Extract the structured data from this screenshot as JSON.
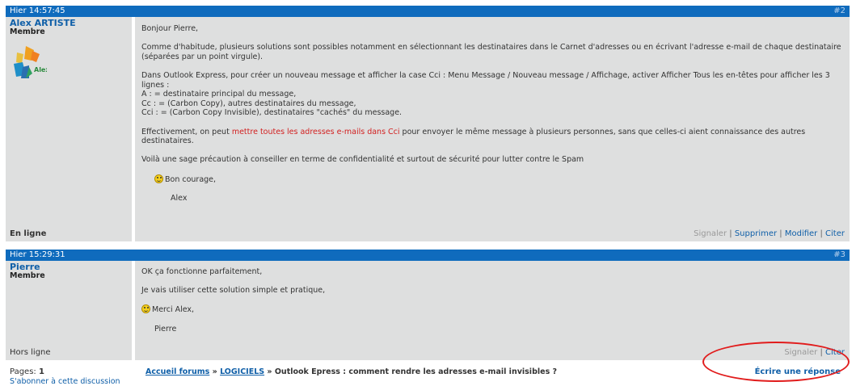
{
  "post1": {
    "time": "Hier 14:57:45",
    "number": "#2",
    "author": "Alex ARTISTE",
    "role": "Membre",
    "status": "En ligne",
    "greeting": "Bonjour Pierre,",
    "p1": "Comme d'habitude, plusieurs solutions sont possibles notamment en sélectionnant les destinataires dans le Carnet d'adresses ou en écrivant l'adresse e-mail de chaque destinataire (séparées par un point virgule).",
    "p2": "Dans Outlook Express, pour créer un nouveau message et afficher la case Cci : Menu Message / Nouveau message / Affichage, activer Afficher Tous les en-têtes pour afficher les 3 lignes :",
    "line_a": "A : = destinataire principal du message,",
    "line_cc": "Cc : = (Carbon Copy), autres destinataires du message,",
    "line_cci": "Cci : = (Carbon Copy Invisible), destinataires \"cachés\" du message.",
    "p3_before": "Effectivement, on peut ",
    "p3_red": "mettre toutes les adresses e-mails dans Cci",
    "p3_after": " pour envoyer le même message à plusieurs personnes, sans que celles-ci aient connaissance des autres destinataires.",
    "p4": "Voilà une sage précaution à conseiller en terme de confidentialité et surtout de sécurité pour lutter contre le Spam",
    "closing": "Bon courage,",
    "signature": "Alex",
    "avatar_text": "Alex",
    "actions": {
      "report": "Signaler",
      "delete": "Supprimer",
      "edit": "Modifier",
      "quote": "Citer"
    }
  },
  "post2": {
    "time": "Hier 15:29:31",
    "number": "#3",
    "author": "Pierre",
    "role": "Membre",
    "status": "Hors ligne",
    "p1": "OK ça fonctionne parfaitement,",
    "p2": "Je vais utiliser cette solution simple et pratique,",
    "closing": "Merci Alex,",
    "signature": "Pierre",
    "actions": {
      "report": "Signaler",
      "quote": "Citer"
    }
  },
  "footer": {
    "pages_label": "Pages:",
    "pages_value": "1",
    "subscribe": "S'abonner à cette discussion",
    "crumb_home": "Accueil forums",
    "crumb_cat": "LOGICIELS",
    "crumb_topic": "Outlook Epress : comment rendre les adresses e-mail invisibles ?",
    "crumb_sep": "»",
    "reply": "Écrire une réponse"
  },
  "colors": {
    "header_bg": "#0f6bbd",
    "body_bg": "#dedfdf",
    "link": "#0f5fa8",
    "highlight": "#d21f1f"
  }
}
